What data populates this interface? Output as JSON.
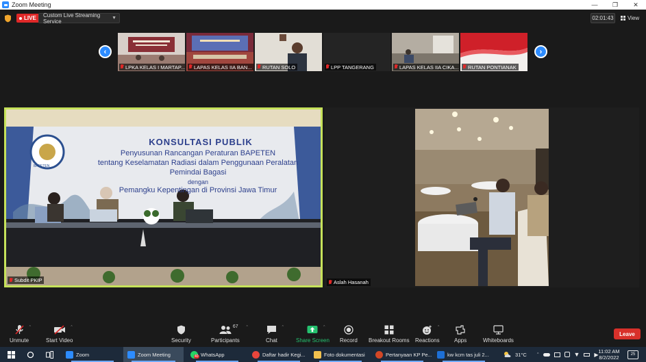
{
  "window": {
    "title": "Zoom Meeting"
  },
  "topbar": {
    "live_label": "LIVE",
    "stream_service": "Custom Live Streaming Service",
    "timer": "02:01:43",
    "view_label": "View"
  },
  "strip": {
    "tiles": [
      {
        "name": "LPKA KELAS I MARTAP...",
        "color": "#8a6a66"
      },
      {
        "name": "LAPAS KELAS IIA BAN...",
        "color": "#8a4a55"
      },
      {
        "name": "RUTAN SOLO",
        "color": "#c9c5bd"
      },
      {
        "name": "LPP TANGERANG",
        "color": "#242424"
      },
      {
        "name": "LAPAS KELAS IIA CIKA...",
        "color": "#8e877d"
      },
      {
        "name": "RUTAN PONTIANAK",
        "color": "#c5262c"
      }
    ]
  },
  "main": {
    "speaker_label": "Subdit PKIP",
    "banner": {
      "line1": "KONSULTASI PUBLIK",
      "line2": "Penyusunan Rancangan Peraturan BAPETEN",
      "line3": "tentang Keselamatan Radiasi dalam Penggunaan Peralatan",
      "line4": "Pemindai Bagasi",
      "line5": "dengan",
      "line6": "Pemangku Kepentingan di Provinsi Jawa Timur",
      "logo_text": "BAPETEN"
    }
  },
  "side": {
    "speaker_label": "Aslah Hasanah"
  },
  "toolbar": {
    "unmute": "Unmute",
    "start_video": "Start Video",
    "security": "Security",
    "participants": "Participants",
    "participants_count": "67",
    "chat": "Chat",
    "share_screen": "Share Screen",
    "record": "Record",
    "breakout_rooms": "Breakout Rooms",
    "reactions": "Reactions",
    "apps": "Apps",
    "whiteboards": "Whiteboards",
    "leave": "Leave",
    "share_color": "#25c16f",
    "leave_color": "#d8302a"
  },
  "taskbar": {
    "items": [
      {
        "label": "Zoom",
        "color": "#2d8cff"
      },
      {
        "label": "Zoom Meeting",
        "color": "#2d8cff"
      },
      {
        "label": "WhatsApp",
        "color": "#25d366",
        "badge": "40"
      },
      {
        "label": "Daftar hadir Kegi...",
        "color": "#e8453c"
      },
      {
        "label": "Foto dokumentasi",
        "color": "#f2c14e"
      },
      {
        "label": "Pertanyaan KP Pe...",
        "color": "#d24726"
      },
      {
        "label": "kw kcm tas juli 2...",
        "color": "#1d6fd6"
      }
    ],
    "weather": "31°C",
    "time": "11:02 AM",
    "date": "8/2/2022",
    "notifications": "25"
  }
}
